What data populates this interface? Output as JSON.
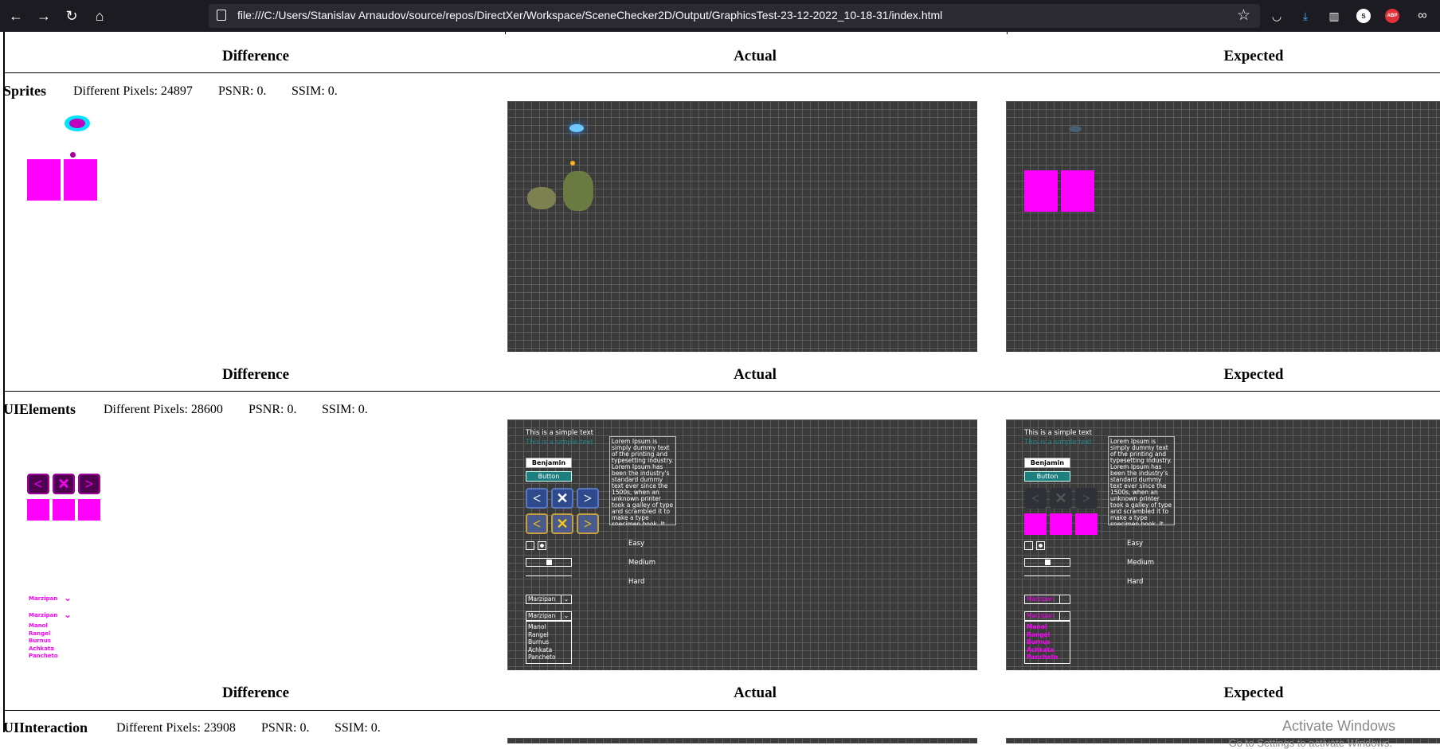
{
  "browser": {
    "url": "file:///C:/Users/Stanislav Arnaudov/source/repos/DirectXer/Workspace/SceneChecker2D/Output/GraphicsTest-23-12-2022_10-18-31/index.html",
    "back_icon": "←",
    "forward_icon": "→",
    "reload_icon": "↻",
    "home_icon": "⌂",
    "star_icon": "☆",
    "pocket_icon": "◡",
    "download_icon": "⤓",
    "reader_icon": "▥",
    "account_badge": "S",
    "abp_badge": "ABP",
    "mask_icon": "∞"
  },
  "columns": {
    "difference": "Difference",
    "actual": "Actual",
    "expected": "Expected"
  },
  "sections": [
    {
      "name": "Sprites",
      "pixels_label": "Different Pixels: 24897",
      "psnr_label": "PSNR: 0.",
      "ssim_label": "SSIM: 0."
    },
    {
      "name": "UIElements",
      "pixels_label": "Different Pixels: 28600",
      "psnr_label": "PSNR: 0.",
      "ssim_label": "SSIM: 0."
    },
    {
      "name": "UIInteraction",
      "pixels_label": "Different Pixels: 23908",
      "psnr_label": "PSNR: 0.",
      "ssim_label": "SSIM: 0."
    }
  ],
  "ui_scene": {
    "simple_text": "This is a simple text",
    "colored_text": "This is a simple text",
    "name_field": "Benjamin",
    "button_label": "Button",
    "lorem": "Lorem Ipsum is simply dummy text of the printing and typesetting industry. Lorem Ipsum has been the industry's standard dummy text ever since the 1500s, when an unknown printer took a galley of type and scrambled it to make a type specimen book. It has survived not only",
    "radio_options": [
      "Easy",
      "Medium",
      "Hard"
    ],
    "dropdown_value": "Marzipan",
    "dropdown_items": [
      "Manol",
      "Rangel",
      "Burnus",
      "Achkata",
      "Pancheto"
    ],
    "left_icon": "<",
    "close_icon": "✕",
    "right_icon": ">",
    "chevron_icon": "⌄"
  },
  "watermark": {
    "title": "Activate Windows",
    "subtitle": "Go to Settings to activate Windows."
  },
  "colors": {
    "chrome_bg": "#1c1b22",
    "missing_texture": "#ff00ff",
    "teal_button": "#1f7f80",
    "grid_bg": "#3a3a3a"
  }
}
